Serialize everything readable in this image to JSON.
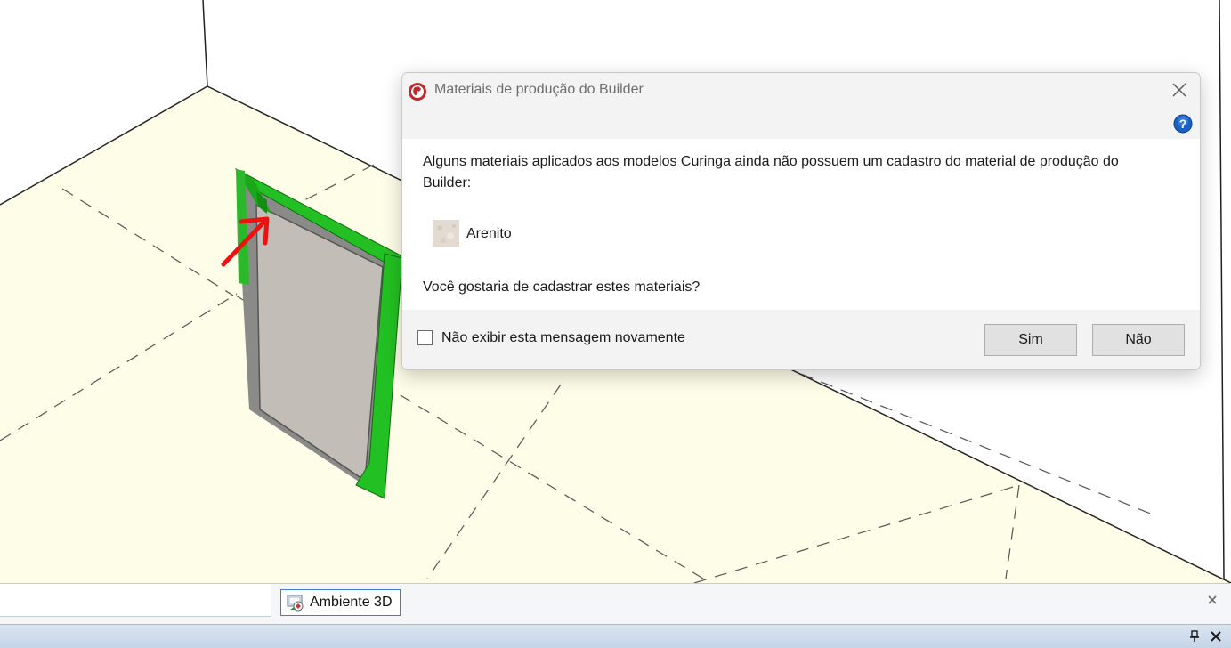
{
  "dialog": {
    "title": "Materiais de produção do Builder",
    "message": "Alguns materiais aplicados aos modelos Curinga ainda não possuem um cadastro do material de produção do Builder:",
    "material_name": "Arenito",
    "question": "Você gostaria de cadastrar estes materiais?",
    "checkbox_label": "Não exibir esta mensagem novamente",
    "checkbox_checked": false,
    "yes_label": "Sim",
    "no_label": "Não"
  },
  "tabs": {
    "active_label": "Ambiente 3D"
  },
  "icons": {
    "app": "builder-app-icon",
    "help": "help-icon",
    "close": "close-icon",
    "tab": "ambiente-3d-icon",
    "pin": "pin-icon"
  },
  "colors": {
    "floor": "#fefde8",
    "door_frame": "#22c022",
    "annotation_arrow": "#ee1111",
    "help_blue": "#1a5fc4",
    "app_red": "#c0272d"
  }
}
